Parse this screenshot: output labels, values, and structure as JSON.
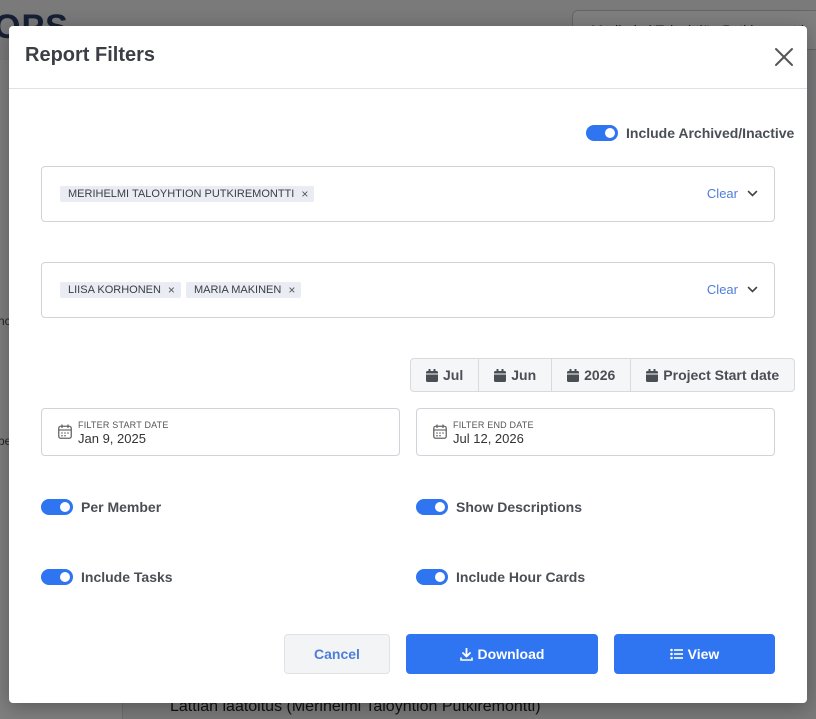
{
  "background": {
    "logo_text": "OPS",
    "project_select": "Merihelmi Taloyhtiön Putkiremontti",
    "edge_text_1": "nc",
    "edge_text_2": "pe",
    "main_row_text": "Lattian laatoitus (Merihelmi Taloyhtion Putkiremontti)"
  },
  "modal": {
    "title": "Report Filters",
    "close_icon": "close-icon",
    "include_archived": {
      "label": "Include Archived/Inactive",
      "checked": true
    },
    "projects": {
      "chips": [
        "MERIHELMI TALOYHTION PUTKIREMONTTI"
      ],
      "clear_label": "Clear"
    },
    "members": {
      "chips": [
        "LIISA KORHONEN",
        "MARIA MAKINEN"
      ],
      "clear_label": "Clear"
    },
    "quick_dates": [
      {
        "label": "Jul",
        "icon": "calendar-icon"
      },
      {
        "label": "Jun",
        "icon": "calendar-icon"
      },
      {
        "label": "2026",
        "icon": "calendar-icon"
      },
      {
        "label": "Project Start date",
        "icon": "calendar-icon"
      }
    ],
    "start_date": {
      "label": "Filter Start Date",
      "value": "Jan 9, 2025"
    },
    "end_date": {
      "label": "Filter End Date",
      "value": "Jul 12, 2026"
    },
    "toggles": {
      "per_member": {
        "label": "Per Member",
        "checked": true
      },
      "show_descriptions": {
        "label": "Show Descriptions",
        "checked": true
      },
      "include_tasks": {
        "label": "Include Tasks",
        "checked": true
      },
      "include_hour_cards": {
        "label": "Include Hour Cards",
        "checked": true
      }
    },
    "buttons": {
      "cancel": "Cancel",
      "download": "Download",
      "view": "View"
    }
  },
  "colors": {
    "primary": "#2f74f1",
    "link": "#4d7ed8",
    "chip_bg": "#e9ecf3"
  }
}
